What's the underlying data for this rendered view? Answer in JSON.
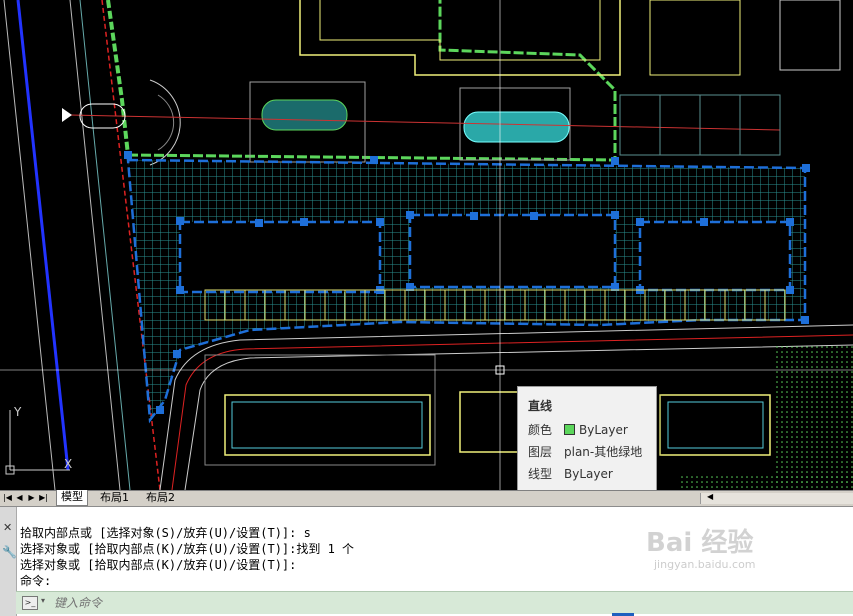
{
  "tooltip": {
    "title": "直线",
    "rows": [
      {
        "key": "颜色",
        "value": "ByLayer",
        "swatch": "#5cd65c"
      },
      {
        "key": "图层",
        "value": "plan-其他绿地"
      },
      {
        "key": "线型",
        "value": "ByLayer"
      }
    ]
  },
  "tabs": {
    "model": "模型",
    "layout1": "布局1",
    "layout2": "布局2"
  },
  "command": {
    "history": [
      "拾取内部点或 [选择对象(S)/放弃(U)/设置(T)]: s",
      "选择对象或 [拾取内部点(K)/放弃(U)/设置(T)]:找到 1 个",
      "选择对象或 [拾取内部点(K)/放弃(U)/设置(T)]:",
      "命令:"
    ],
    "input_placeholder": "键入命令"
  },
  "ucs": {
    "x_label": "X",
    "y_label": "Y"
  },
  "watermark": {
    "brand": "Bai 经验",
    "url": "jingyan.baidu.com"
  },
  "colors": {
    "background": "#000000",
    "hatch": "#2a8f8f",
    "selected": "#1e6fd9",
    "green_line": "#5cd65c",
    "road_red": "#d22",
    "road_blue": "#2233ff",
    "building_yellow": "#f0f07a"
  }
}
